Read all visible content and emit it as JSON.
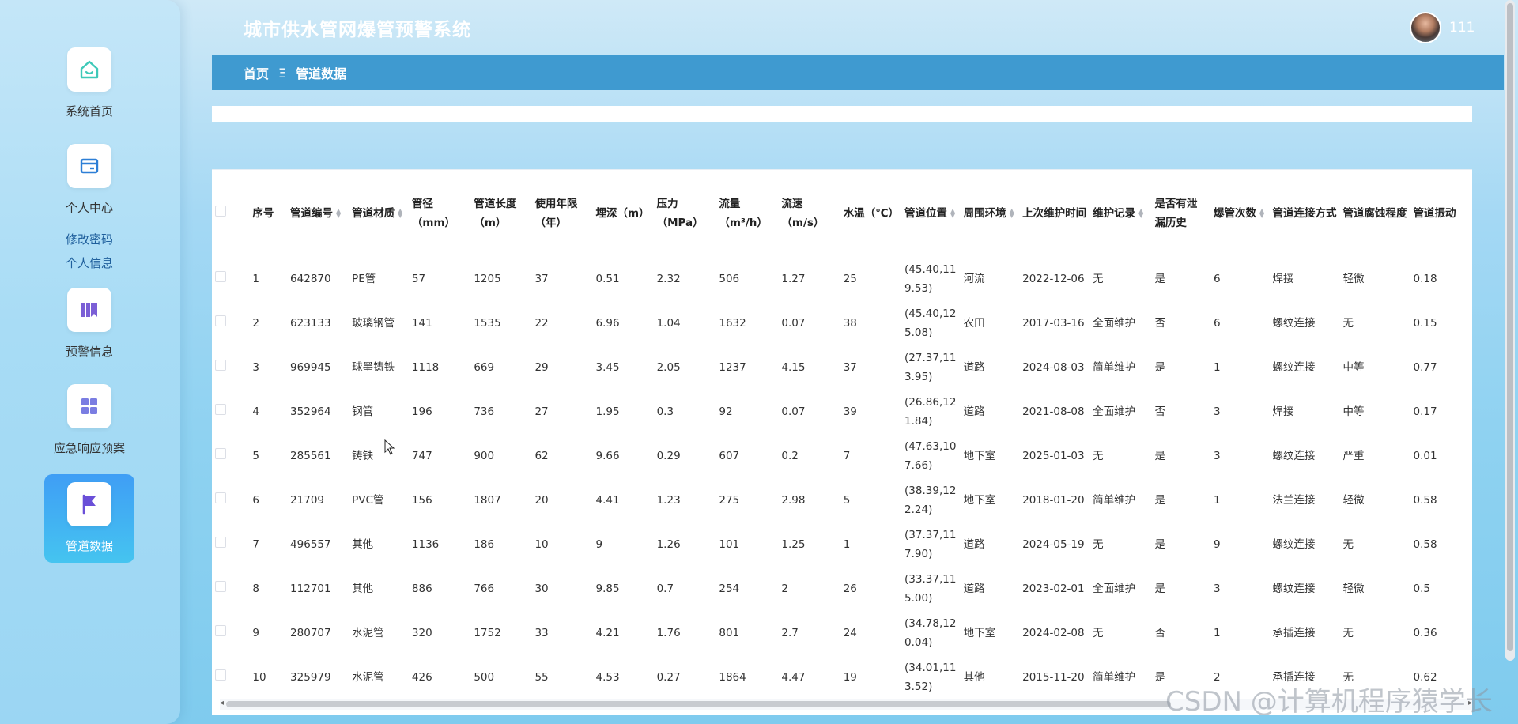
{
  "app": {
    "title": "城市供水管网爆管预警系统",
    "username": "111"
  },
  "sidebar": {
    "items": [
      {
        "label": "系统首页",
        "icon": "home-icon"
      },
      {
        "label": "个人中心",
        "icon": "card-icon"
      },
      {
        "label": "预警信息",
        "icon": "books-icon"
      },
      {
        "label": "应急响应预案",
        "icon": "grid-icon"
      },
      {
        "label": "管道数据",
        "icon": "flag-icon"
      }
    ],
    "subitems": [
      {
        "label": "修改密码"
      },
      {
        "label": "个人信息"
      }
    ],
    "active_index": 4
  },
  "breadcrumb": {
    "home": "首页",
    "separator": "Ξ",
    "current": "管道数据"
  },
  "table": {
    "headers": [
      "序号",
      "管道编号",
      "管道材质",
      "管径（mm）",
      "管道长度（m）",
      "使用年限（年）",
      "埋深（m）",
      "压力（MPa）",
      "流量（m³/h）",
      "流速（m/s）",
      "水温（℃）",
      "管道位置",
      "周围环境",
      "上次维护时间",
      "维护记录",
      "是否有泄漏历史",
      "爆管次数",
      "管道连接方式",
      "管道腐蚀程度",
      "管道振动"
    ],
    "rows": [
      [
        "1",
        "642870",
        "PE管",
        "57",
        "1205",
        "37",
        "0.51",
        "2.32",
        "506",
        "1.27",
        "25",
        "(45.40,119.53)",
        "河流",
        "2022-12-06",
        "无",
        "是",
        "6",
        "焊接",
        "轻微",
        "0.18"
      ],
      [
        "2",
        "623133",
        "玻璃钢管",
        "141",
        "1535",
        "22",
        "6.96",
        "1.04",
        "1632",
        "0.07",
        "38",
        "(45.40,125.08)",
        "农田",
        "2017-03-16",
        "全面维护",
        "否",
        "6",
        "螺纹连接",
        "无",
        "0.15"
      ],
      [
        "3",
        "969945",
        "球墨铸铁",
        "1118",
        "669",
        "29",
        "3.45",
        "2.05",
        "1237",
        "4.15",
        "37",
        "(27.37,113.95)",
        "道路",
        "2024-08-03",
        "简单维护",
        "是",
        "1",
        "螺纹连接",
        "中等",
        "0.77"
      ],
      [
        "4",
        "352964",
        "钢管",
        "196",
        "736",
        "27",
        "1.95",
        "0.3",
        "92",
        "0.07",
        "39",
        "(26.86,121.84)",
        "道路",
        "2021-08-08",
        "全面维护",
        "否",
        "3",
        "焊接",
        "中等",
        "0.17"
      ],
      [
        "5",
        "285561",
        "铸铁",
        "747",
        "900",
        "62",
        "9.66",
        "0.29",
        "607",
        "0.2",
        "7",
        "(47.63,107.66)",
        "地下室",
        "2025-01-03",
        "无",
        "是",
        "3",
        "螺纹连接",
        "严重",
        "0.01"
      ],
      [
        "6",
        "21709",
        "PVC管",
        "156",
        "1807",
        "20",
        "4.41",
        "1.23",
        "275",
        "2.98",
        "5",
        "(38.39,122.24)",
        "地下室",
        "2018-01-20",
        "简单维护",
        "是",
        "1",
        "法兰连接",
        "轻微",
        "0.58"
      ],
      [
        "7",
        "496557",
        "其他",
        "1136",
        "186",
        "10",
        "9",
        "1.26",
        "101",
        "1.25",
        "1",
        "(37.37,117.90)",
        "道路",
        "2024-05-19",
        "无",
        "是",
        "9",
        "螺纹连接",
        "无",
        "0.58"
      ],
      [
        "8",
        "112701",
        "其他",
        "886",
        "766",
        "30",
        "9.85",
        "0.7",
        "254",
        "2",
        "26",
        "(33.37,115.00)",
        "道路",
        "2023-02-01",
        "全面维护",
        "是",
        "3",
        "螺纹连接",
        "轻微",
        "0.5"
      ],
      [
        "9",
        "280707",
        "水泥管",
        "320",
        "1752",
        "33",
        "4.21",
        "1.76",
        "801",
        "2.7",
        "24",
        "(34.78,120.04)",
        "地下室",
        "2024-02-08",
        "无",
        "否",
        "1",
        "承插连接",
        "无",
        "0.36"
      ],
      [
        "10",
        "325979",
        "水泥管",
        "426",
        "500",
        "55",
        "4.53",
        "0.27",
        "1864",
        "4.47",
        "19",
        "(34.01,113.52)",
        "其他",
        "2015-11-20",
        "简单维护",
        "是",
        "2",
        "承插连接",
        "无",
        "0.62"
      ]
    ]
  },
  "watermark": "CSDN @计算机程序猿学长"
}
